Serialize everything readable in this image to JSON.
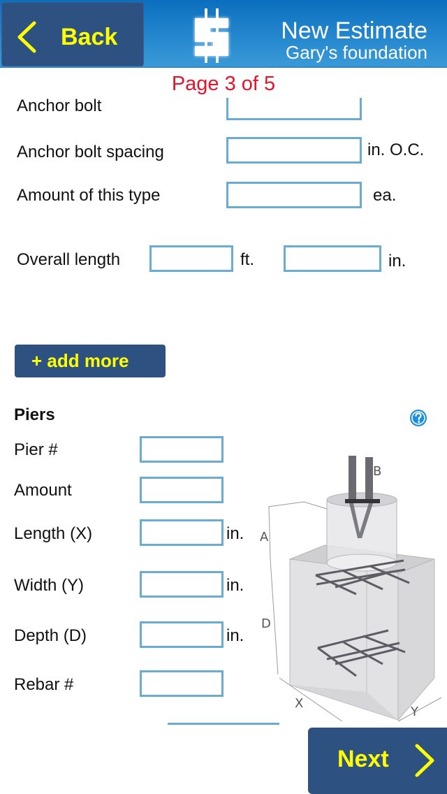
{
  "header": {
    "back_label": "Back",
    "title": "New Estimate",
    "subtitle": "Gary's foundation",
    "logo_icon": "dollar-sign-logo"
  },
  "page_indicator": "Page 3 of 5",
  "anchor_section": {
    "partial_label": "Anchor bolt",
    "fields": [
      {
        "label": "Anchor bolt spacing",
        "value": "",
        "unit": "in. O.C."
      },
      {
        "label": "Amount of this type",
        "value": "",
        "unit": "ea."
      }
    ],
    "overall_length": {
      "label": "Overall length",
      "feet_value": "",
      "feet_unit": "ft.",
      "inches_value": "",
      "inches_unit": "in."
    },
    "add_more_label": "+ add more"
  },
  "piers": {
    "title": "Piers",
    "help_icon": "question-mark-icon",
    "fields": [
      {
        "label": "Pier #",
        "value": "",
        "unit": ""
      },
      {
        "label": "Amount",
        "value": "",
        "unit": ""
      },
      {
        "label": "Length (X)",
        "value": "",
        "unit": "in."
      },
      {
        "label": "Width (Y)",
        "value": "",
        "unit": "in."
      },
      {
        "label": "Depth (D)",
        "value": "",
        "unit": "in."
      },
      {
        "label": "Rebar #",
        "value": "",
        "unit": ""
      }
    ],
    "diagram_labels": {
      "a": "A",
      "b": "B",
      "d": "D",
      "x": "X",
      "y": "Y"
    }
  },
  "footer": {
    "next_label": "Next"
  },
  "colors": {
    "header_blue": "#1a80cc",
    "button_navy": "#2d5282",
    "button_text_yellow": "#ffff00",
    "page_indicator_red": "#e8132b",
    "field_border": "#6aabd2"
  }
}
